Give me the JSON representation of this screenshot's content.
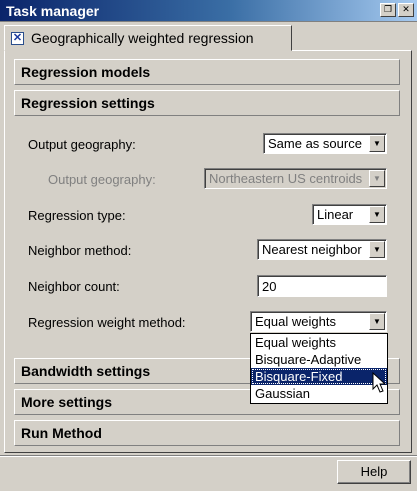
{
  "window": {
    "title": "Task manager"
  },
  "tab": {
    "label": "Geographically weighted regression",
    "checked_glyph": "✕"
  },
  "sections": {
    "regression_models": "Regression models",
    "regression_settings": "Regression settings",
    "bandwidth_settings": "Bandwidth settings",
    "more_settings": "More settings",
    "run_method": "Run Method"
  },
  "form": {
    "output_geography": {
      "label": "Output geography:",
      "value": "Same as source"
    },
    "output_geography_sub": {
      "label": "Output geography:",
      "value": "Northeastern US centroids"
    },
    "regression_type": {
      "label": "Regression type:",
      "value": "Linear"
    },
    "neighbor_method": {
      "label": "Neighbor method:",
      "value": "Nearest neighbor"
    },
    "neighbor_count": {
      "label": "Neighbor count:",
      "value": "20"
    },
    "weight_method": {
      "label": "Regression weight method:",
      "value": "Equal weights",
      "options": [
        "Equal weights",
        "Bisquare-Adaptive",
        "Bisquare-Fixed",
        "Gaussian"
      ],
      "highlighted": "Bisquare-Fixed"
    }
  },
  "footer": {
    "help_label": "Help"
  },
  "icons": {
    "restore": "restore-icon",
    "close": "close-icon",
    "dropdown": "chevron-down-icon",
    "cursor": "mouse-pointer-icon"
  }
}
